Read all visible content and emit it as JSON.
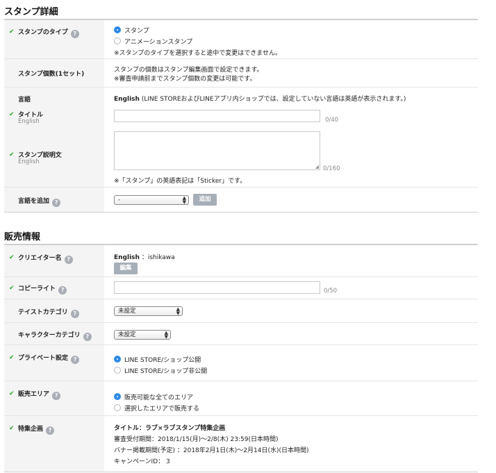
{
  "sections": {
    "sticker_details_title": "スタンプ詳細",
    "sales_info_title": "販売情報"
  },
  "sticker_type": {
    "label": "スタンプのタイプ",
    "options": [
      "スタンプ",
      "アニメーションスタンプ"
    ],
    "selected": "スタンプ",
    "note": "※スタンプのタイプを選択すると途中で変更はできません。"
  },
  "sticker_count": {
    "label": "スタンプ個数(1セット)",
    "line1": "スタンプの個数はスタンプ編集画面で設定できます。",
    "line2": "※審査申請前までスタンプ個数の変更は可能です。"
  },
  "language": {
    "label": "言語",
    "value": "English",
    "note": "(LINE STOREおよびLINEアプリ内ショップでは、設定していない言語は英語が表示されます。)"
  },
  "title_field": {
    "label": "タイトル",
    "sublabel": "English",
    "value": "",
    "counter": "0/40"
  },
  "description_field": {
    "label": "スタンプ説明文",
    "sublabel": "English",
    "value": "",
    "counter": "0/160",
    "note": "※「スタンプ」の英語表記は「Sticker」です。"
  },
  "add_language": {
    "label": "言語を追加",
    "select_value": "-",
    "button": "追加"
  },
  "creator_name": {
    "label": "クリエイター名",
    "lang": "English",
    "value": "：ishikawa",
    "button": "編集"
  },
  "copyright": {
    "label": "コピーライト",
    "value": "",
    "counter": "0/50"
  },
  "taste_category": {
    "label": "テイストカテゴリ",
    "select_value": "未設定"
  },
  "character_category": {
    "label": "キャラクターカテゴリ",
    "select_value": "未設定"
  },
  "private_setting": {
    "label": "プライベート設定",
    "options": [
      "LINE STORE/ショップ公開",
      "LINE STORE/ショップ非公開"
    ],
    "selected": "LINE STORE/ショップ公開"
  },
  "sales_area": {
    "label": "販売エリア",
    "options": [
      "販売可能な全てのエリア",
      "選択したエリアで販売する"
    ],
    "selected": "販売可能な全てのエリア"
  },
  "campaign": {
    "label": "特集企画",
    "title": "タイトル：ラブ×ラブスタンプ特集企画",
    "review_period": "審査受付期間：2018/1/15(月)〜2/8(木) 23:59(日本時間)",
    "banner_period": "バナー掲載期間(予定) ：2018年2月1日(木)〜2月14日(水)(日本時間)",
    "campaign_id": "キャンペーンID： 3"
  },
  "icons": {
    "check": "check-icon",
    "help": "help-icon",
    "select_arrows": "select-arrows-icon",
    "textarea_resize": "resize-handle-icon"
  },
  "colors": {
    "check_green": "#2aa52a",
    "radio_blue": "#2d8ae8",
    "button_gray": "#a6aeb8",
    "label_bg": "#f4f4f4"
  }
}
